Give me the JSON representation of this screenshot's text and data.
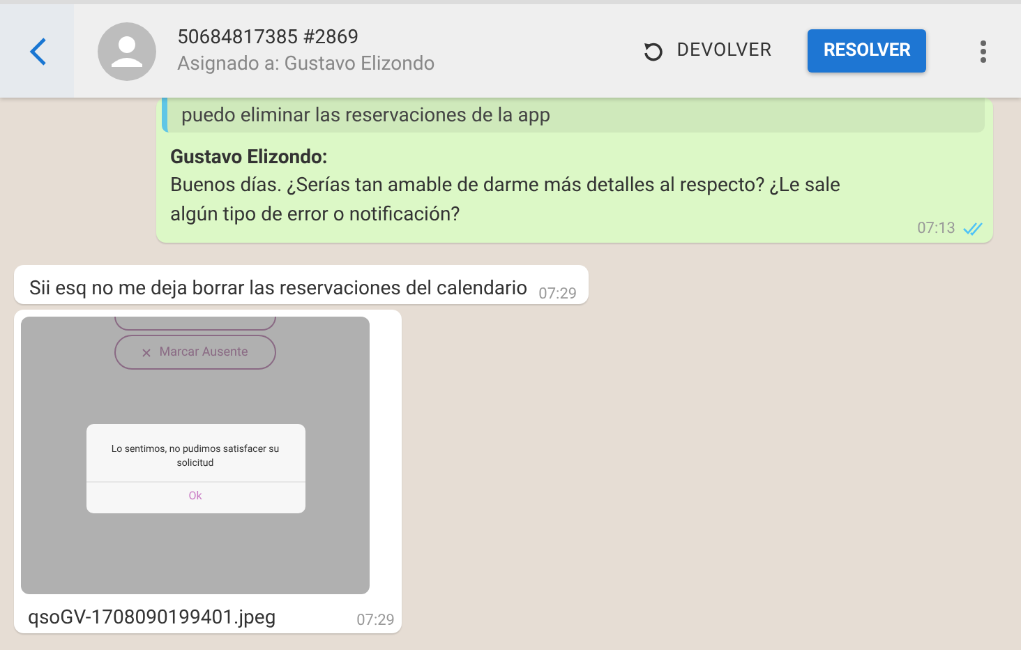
{
  "header": {
    "title": "50684817385 #2869",
    "subtitle": "Asignado a: Gustavo Elizondo",
    "return_button": "DEVOLVER",
    "resolve_button": "RESOLVER"
  },
  "messages": [
    {
      "kind": "outgoing",
      "quote": "puedo eliminar las reservaciones de la app",
      "author": "Gustavo Elizondo:",
      "text": "Buenos días. ¿Serías tan amable de darme más detalles al respecto? ¿Le sale algún tipo de error o notificación?",
      "time": "07:13",
      "read": true
    },
    {
      "kind": "incoming",
      "text": "Sii esq no me deja borrar las reservaciones del calendario",
      "time": "07:29"
    },
    {
      "kind": "image",
      "shot": {
        "button": "Marcar Ausente",
        "dialog_text": "Lo sentimos, no pudimos satisfacer su solicitud",
        "dialog_button": "Ok"
      },
      "filename": "qsoGV-1708090199401.jpeg",
      "time": "07:29"
    }
  ]
}
